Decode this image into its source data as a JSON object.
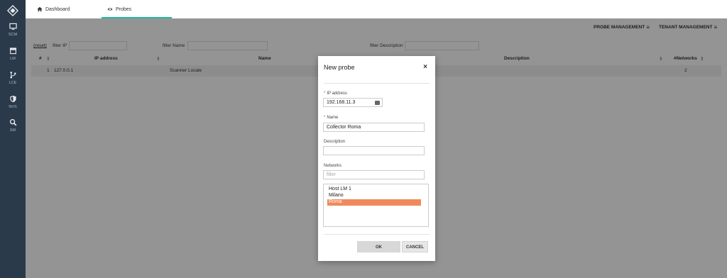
{
  "sidebar": {
    "items": [
      {
        "label": "SCM",
        "icon": "monitor-icon"
      },
      {
        "label": "LM",
        "icon": "archive-icon"
      },
      {
        "label": "LCE",
        "icon": "branch-icon"
      },
      {
        "label": "NVS",
        "icon": "shield-icon"
      },
      {
        "label": "SM",
        "icon": "search-icon"
      }
    ]
  },
  "tabs": [
    {
      "label": "Dashboard",
      "icon": "home-icon"
    },
    {
      "label": "Probes",
      "icon": "eye-icon",
      "active": true
    }
  ],
  "header": {
    "probe_management": "PROBE MANAGEMENT",
    "tenant_management": "TENANT MANAGEMENT",
    "hamburger": "≡"
  },
  "filters": {
    "reset": "(reset)",
    "ip_label": "filter IP",
    "name_label": "filter Name",
    "description_label": "filter Description"
  },
  "table": {
    "columns": {
      "num": "#",
      "ip": "IP address",
      "name": "Name",
      "description": "Description",
      "networks": "#Networks"
    },
    "sort_glyph": "⇕",
    "rows": [
      {
        "num": "1",
        "ip": "127.0.0.1",
        "name": "Scanner Locale",
        "description": "",
        "networks": "2"
      }
    ]
  },
  "modal": {
    "title": "New probe",
    "close": "×",
    "ip_label": "IP address",
    "ip_value": "192.168.11.3",
    "name_label": "Name",
    "name_value": "Collector Roma",
    "description_label": "Description",
    "description_value": "",
    "networks_label": "Networks",
    "networks_filter_placeholder": "filter",
    "networks": [
      {
        "label": "Host LM 1",
        "selected": false
      },
      {
        "label": "Milano",
        "selected": false
      },
      {
        "label": "Roma",
        "selected": true
      }
    ],
    "ok": "OK",
    "cancel": "CANCEL",
    "required_mark": "*"
  },
  "colors": {
    "sidebar_bg": "#2b3a4a",
    "tab_accent": "#1fb99b",
    "selected_option": "#f08a5d",
    "required": "#e0443a"
  }
}
